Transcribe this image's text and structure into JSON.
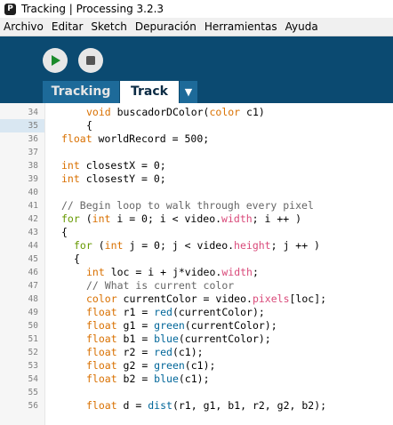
{
  "window": {
    "icon_letter": "P",
    "title": "Tracking | Processing 3.2.3"
  },
  "menu": [
    "Archivo",
    "Editar",
    "Sketch",
    "Depuración",
    "Herramientas",
    "Ayuda"
  ],
  "toolbar": {
    "run_icon": "play-icon",
    "stop_icon": "stop-icon"
  },
  "tabs": {
    "items": [
      {
        "label": "Tracking",
        "active": false
      },
      {
        "label": "Track",
        "active": true
      }
    ],
    "menu_glyph": "▼"
  },
  "colors": {
    "toolbar_bg": "#0b4a71",
    "tab_inactive_bg": "#1d6a99",
    "keyword_type": "#d97000",
    "keyword_control": "#669900",
    "function": "#006699",
    "comment": "#666666",
    "field": "#d94a7a"
  },
  "editor": {
    "current_line": 35,
    "lines": [
      {
        "n": 34,
        "indent": 2,
        "tokens": [
          [
            "kw-type",
            "void"
          ],
          [
            "plain",
            " buscadorDColor("
          ],
          [
            "kw-type",
            "color"
          ],
          [
            "plain",
            " c1)"
          ]
        ]
      },
      {
        "n": 35,
        "indent": 2,
        "tokens": [
          [
            "plain",
            "{"
          ]
        ]
      },
      {
        "n": 36,
        "indent": 0,
        "tokens": [
          [
            "kw-type",
            "float"
          ],
          [
            "plain",
            " worldRecord = 500;"
          ]
        ]
      },
      {
        "n": 37,
        "indent": 0,
        "tokens": []
      },
      {
        "n": 38,
        "indent": 0,
        "tokens": [
          [
            "kw-type",
            "int"
          ],
          [
            "plain",
            " closestX = 0;"
          ]
        ]
      },
      {
        "n": 39,
        "indent": 0,
        "tokens": [
          [
            "kw-type",
            "int"
          ],
          [
            "plain",
            " closestY = 0;"
          ]
        ]
      },
      {
        "n": 40,
        "indent": 0,
        "tokens": []
      },
      {
        "n": 41,
        "indent": 0,
        "tokens": [
          [
            "comment",
            "// Begin loop to walk through every pixel"
          ]
        ]
      },
      {
        "n": 42,
        "indent": 0,
        "tokens": [
          [
            "kw-ctrl",
            "for"
          ],
          [
            "plain",
            " ("
          ],
          [
            "kw-type",
            "int"
          ],
          [
            "plain",
            " i = 0; i < video."
          ],
          [
            "field",
            "width"
          ],
          [
            "plain",
            "; i ++ )"
          ]
        ]
      },
      {
        "n": 43,
        "indent": 0,
        "tokens": [
          [
            "plain",
            "{"
          ]
        ]
      },
      {
        "n": 44,
        "indent": 1,
        "tokens": [
          [
            "kw-ctrl",
            "for"
          ],
          [
            "plain",
            " ("
          ],
          [
            "kw-type",
            "int"
          ],
          [
            "plain",
            " j = 0; j < video."
          ],
          [
            "field",
            "height"
          ],
          [
            "plain",
            "; j ++ )"
          ]
        ]
      },
      {
        "n": 45,
        "indent": 1,
        "tokens": [
          [
            "plain",
            "{"
          ]
        ]
      },
      {
        "n": 46,
        "indent": 2,
        "tokens": [
          [
            "kw-type",
            "int"
          ],
          [
            "plain",
            " loc = i + j*video."
          ],
          [
            "field",
            "width"
          ],
          [
            "plain",
            ";"
          ]
        ]
      },
      {
        "n": 47,
        "indent": 2,
        "tokens": [
          [
            "comment",
            "// What is current color"
          ]
        ]
      },
      {
        "n": 48,
        "indent": 2,
        "tokens": [
          [
            "kw-type",
            "color"
          ],
          [
            "plain",
            " currentColor = video."
          ],
          [
            "field",
            "pixels"
          ],
          [
            "plain",
            "[loc];"
          ]
        ]
      },
      {
        "n": 49,
        "indent": 2,
        "tokens": [
          [
            "kw-type",
            "float"
          ],
          [
            "plain",
            " r1 = "
          ],
          [
            "fn",
            "red"
          ],
          [
            "plain",
            "(currentColor);"
          ]
        ]
      },
      {
        "n": 50,
        "indent": 2,
        "tokens": [
          [
            "kw-type",
            "float"
          ],
          [
            "plain",
            " g1 = "
          ],
          [
            "fn",
            "green"
          ],
          [
            "plain",
            "(currentColor);"
          ]
        ]
      },
      {
        "n": 51,
        "indent": 2,
        "tokens": [
          [
            "kw-type",
            "float"
          ],
          [
            "plain",
            " b1 = "
          ],
          [
            "fn",
            "blue"
          ],
          [
            "plain",
            "(currentColor);"
          ]
        ]
      },
      {
        "n": 52,
        "indent": 2,
        "tokens": [
          [
            "kw-type",
            "float"
          ],
          [
            "plain",
            " r2 = "
          ],
          [
            "fn",
            "red"
          ],
          [
            "plain",
            "(c1);"
          ]
        ]
      },
      {
        "n": 53,
        "indent": 2,
        "tokens": [
          [
            "kw-type",
            "float"
          ],
          [
            "plain",
            " g2 = "
          ],
          [
            "fn",
            "green"
          ],
          [
            "plain",
            "(c1);"
          ]
        ]
      },
      {
        "n": 54,
        "indent": 2,
        "tokens": [
          [
            "kw-type",
            "float"
          ],
          [
            "plain",
            " b2 = "
          ],
          [
            "fn",
            "blue"
          ],
          [
            "plain",
            "(c1);"
          ]
        ]
      },
      {
        "n": 55,
        "indent": 0,
        "tokens": []
      },
      {
        "n": 56,
        "indent": 2,
        "tokens": [
          [
            "kw-type",
            "float"
          ],
          [
            "plain",
            " d = "
          ],
          [
            "fn",
            "dist"
          ],
          [
            "plain",
            "(r1, g1, b1, r2, g2, b2);"
          ]
        ]
      }
    ]
  }
}
